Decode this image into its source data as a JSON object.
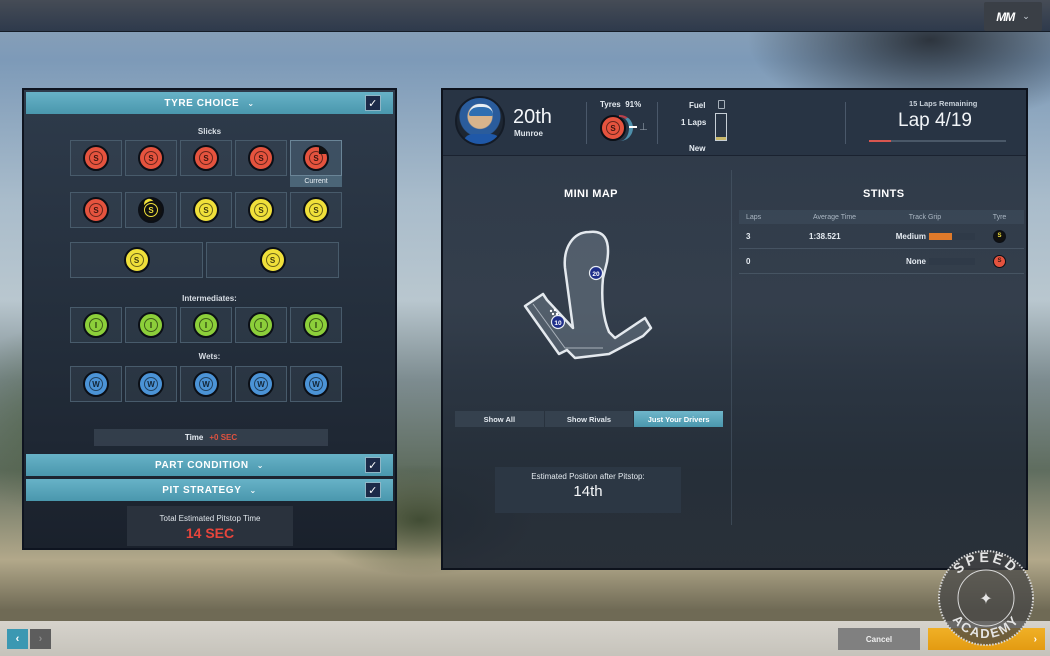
{
  "top_menu": {
    "logo": "MM",
    "chevron": "chevron-down-icon"
  },
  "tyre_choice": {
    "title": "TYRE CHOICE",
    "checked": true,
    "slicks_label": "Slicks",
    "slicks": [
      [
        {
          "compound": "soft",
          "letter": "S"
        },
        {
          "compound": "soft",
          "letter": "S"
        },
        {
          "compound": "soft",
          "letter": "S"
        },
        {
          "compound": "soft",
          "letter": "S"
        },
        {
          "compound": "soft",
          "letter": "S",
          "current": true,
          "worn": true
        }
      ],
      [
        {
          "compound": "soft",
          "letter": "S"
        },
        {
          "compound": "supersoft-used",
          "letter": "S"
        },
        {
          "compound": "supersoft",
          "letter": "S"
        },
        {
          "compound": "supersoft",
          "letter": "S"
        },
        {
          "compound": "supersoft",
          "letter": "S"
        }
      ],
      [
        {
          "compound": "supersoft",
          "letter": "S"
        },
        {
          "compound": "supersoft",
          "letter": "S"
        }
      ]
    ],
    "current_label": "Current",
    "intermediates_label": "Intermediates:",
    "intermediates": [
      "I",
      "I",
      "I",
      "I",
      "I"
    ],
    "wets_label": "Wets:",
    "wets": [
      "W",
      "W",
      "W",
      "W",
      "W"
    ],
    "time_label": "Time",
    "time_value": "+0 SEC"
  },
  "part_condition": {
    "title": "PART CONDITION",
    "checked": true
  },
  "pit_strategy": {
    "title": "PIT STRATEGY",
    "checked": true
  },
  "pit_total": {
    "label": "Total Estimated Pitstop Time",
    "value": "14 SEC"
  },
  "driver": {
    "position": "20th",
    "name": "Munroe",
    "tyres_label": "Tyres",
    "tyres_pct": "91%",
    "fuel_label": "Fuel",
    "fuel_laps": "1 Laps",
    "fuel_level": 0.1,
    "fuel_status": "New"
  },
  "race": {
    "laps_remaining": "15 Laps Remaining",
    "lap": "Lap 4/19",
    "progress": 0.16
  },
  "minimap": {
    "title": "MINI MAP",
    "markers": [
      "20",
      "10"
    ],
    "filters": [
      "Show All",
      "Show Rivals",
      "Just Your Drivers"
    ],
    "active_filter": 2
  },
  "estimate": {
    "label": "Estimated Position after Pitstop:",
    "value": "14th"
  },
  "stints": {
    "title": "STINTS",
    "headers": [
      "Laps",
      "Average Time",
      "Track Grip",
      "Tyre"
    ],
    "rows": [
      {
        "laps": "3",
        "avg": "1:38.521",
        "grip": "Medium",
        "grip_level": 0.5,
        "tyre": "supersoft-used",
        "tyre_letter": "S"
      },
      {
        "laps": "0",
        "avg": "",
        "grip": "None",
        "grip_level": 0,
        "tyre": "soft",
        "tyre_letter": "S"
      }
    ]
  },
  "bottom": {
    "cancel": "Cancel",
    "confirm_arrow": "›",
    "prev": "‹",
    "next": "›"
  },
  "watermark": {
    "top": "SPEED",
    "bottom": "ACADEMY"
  },
  "colors": {
    "accent": "#4a97ad",
    "soft": "#e5533e",
    "supersoft": "#f0e03a",
    "inter": "#8ccf3a",
    "wet": "#4b93d6",
    "confirm": "#e39b12"
  }
}
